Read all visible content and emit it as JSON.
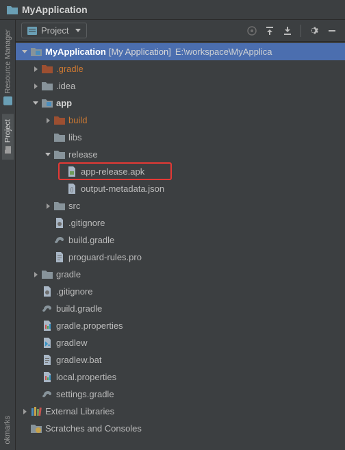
{
  "titlebar": {
    "title": "MyApplication"
  },
  "side_tabs": {
    "resource_manager": "Resource Manager",
    "project": "Project",
    "bookmarks": "okmarks"
  },
  "toolbar": {
    "selector_label": "Project"
  },
  "tree": {
    "root": {
      "name": "MyApplication",
      "desc": "[My Application]",
      "path": "E:\\workspace\\MyApplica"
    },
    "gradle_dir": ".gradle",
    "idea_dir": ".idea",
    "app": {
      "name": "app",
      "build": "build",
      "libs": "libs",
      "release": {
        "name": "release",
        "apk": "app-release.apk",
        "metadata": "output-metadata.json"
      },
      "src": "src",
      "gitignore": ".gitignore",
      "build_gradle": "build.gradle",
      "proguard": "proguard-rules.pro"
    },
    "gradle": "gradle",
    "root_gitignore": ".gitignore",
    "root_build_gradle": "build.gradle",
    "gradle_properties": "gradle.properties",
    "gradlew": "gradlew",
    "gradlew_bat": "gradlew.bat",
    "local_properties": "local.properties",
    "settings_gradle": "settings.gradle",
    "external_libs": "External Libraries",
    "scratches": "Scratches and Consoles"
  }
}
